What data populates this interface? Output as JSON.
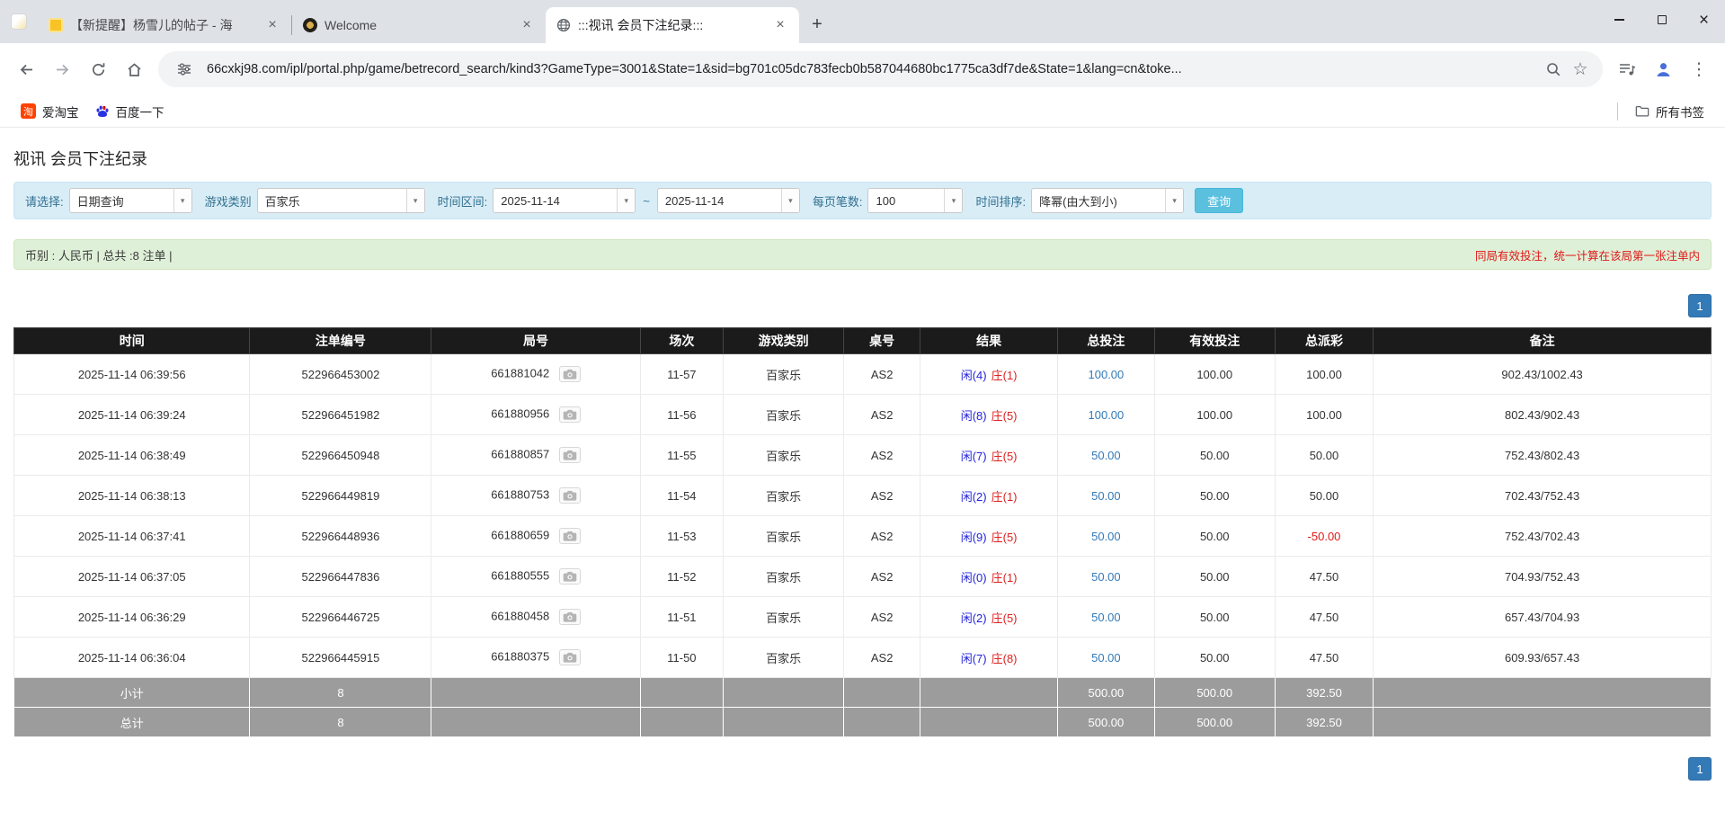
{
  "colors": {
    "filter_bar_bg": "#d9edf7",
    "summary_bar_bg": "#dff0d8",
    "search_button_bg": "#5bc0de",
    "pager_blue": "#337ab7",
    "table_header_bg": "#1b1b1b",
    "footer_row_bg": "#9c9c9c",
    "player_blue": "#2222dd",
    "banker_red": "#dd2222",
    "negative_red": "#e01717",
    "link_blue": "#337ab7"
  },
  "icons": {
    "close": "×",
    "new_tab": "+",
    "chevron_down": "▾",
    "star": "☆",
    "menu": "⋮",
    "window_close": "×"
  },
  "browser": {
    "tabs": [
      {
        "title": "【新提醒】杨雪儿的帖子 - 海"
      },
      {
        "title": "Welcome"
      },
      {
        "title": ":::视讯 会员下注纪录:::"
      }
    ],
    "url": "66cxkj98.com/ipl/portal.php/game/betrecord_search/kind3?GameType=3001&State=1&sid=bg701c05dc783fecb0b587044680bc1775ca3df7de&State=1&lang=cn&toke...",
    "bookmarks": {
      "taobao_label": "爱淘宝",
      "taobao_glyph": "淘",
      "baidu_label": "百度一下",
      "all_bookmarks_label": "所有书签"
    }
  },
  "page": {
    "title": "视讯 会员下注纪录",
    "filters": {
      "select_label": "请选择:",
      "select_value": "日期查询",
      "game_type_label": "游戏类别",
      "game_type_value": "百家乐",
      "date_range_label": "时间区间:",
      "date_from": "2025-11-14",
      "date_separator": "~",
      "date_to": "2025-11-14",
      "page_size_label": "每页笔数:",
      "page_size_value": "100",
      "sort_label": "时间排序:",
      "sort_value": "降幂(由大到小)",
      "search_button": "查询"
    },
    "summary": {
      "left": "币别 : 人民币 | 总共 :8 注单 |",
      "right": "同局有效投注，统一计算在该局第一张注单内"
    },
    "pagination": "1",
    "table": {
      "headers": [
        "时间",
        "注单编号",
        "局号",
        "场次",
        "游戏类别",
        "桌号",
        "结果",
        "总投注",
        "有效投注",
        "总派彩",
        "备注"
      ],
      "rows": [
        {
          "time": "2025-11-14 06:39:56",
          "bet_id": "522966453002",
          "round": "661881042",
          "session": "11-57",
          "game": "百家乐",
          "table_no": "AS2",
          "result_player": "闲(4)",
          "result_banker": "庄(1)",
          "total_bet": "100.00",
          "valid_bet": "100.00",
          "payout": "100.00",
          "note": "902.43/1002.43"
        },
        {
          "time": "2025-11-14 06:39:24",
          "bet_id": "522966451982",
          "round": "661880956",
          "session": "11-56",
          "game": "百家乐",
          "table_no": "AS2",
          "result_player": "闲(8)",
          "result_banker": "庄(5)",
          "total_bet": "100.00",
          "valid_bet": "100.00",
          "payout": "100.00",
          "note": "802.43/902.43"
        },
        {
          "time": "2025-11-14 06:38:49",
          "bet_id": "522966450948",
          "round": "661880857",
          "session": "11-55",
          "game": "百家乐",
          "table_no": "AS2",
          "result_player": "闲(7)",
          "result_banker": "庄(5)",
          "total_bet": "50.00",
          "valid_bet": "50.00",
          "payout": "50.00",
          "note": "752.43/802.43"
        },
        {
          "time": "2025-11-14 06:38:13",
          "bet_id": "522966449819",
          "round": "661880753",
          "session": "11-54",
          "game": "百家乐",
          "table_no": "AS2",
          "result_player": "闲(2)",
          "result_banker": "庄(1)",
          "total_bet": "50.00",
          "valid_bet": "50.00",
          "payout": "50.00",
          "note": "702.43/752.43"
        },
        {
          "time": "2025-11-14 06:37:41",
          "bet_id": "522966448936",
          "round": "661880659",
          "session": "11-53",
          "game": "百家乐",
          "table_no": "AS2",
          "result_player": "闲(9)",
          "result_banker": "庄(5)",
          "total_bet": "50.00",
          "valid_bet": "50.00",
          "payout": "-50.00",
          "note": "752.43/702.43"
        },
        {
          "time": "2025-11-14 06:37:05",
          "bet_id": "522966447836",
          "round": "661880555",
          "session": "11-52",
          "game": "百家乐",
          "table_no": "AS2",
          "result_player": "闲(0)",
          "result_banker": "庄(1)",
          "total_bet": "50.00",
          "valid_bet": "50.00",
          "payout": "47.50",
          "note": "704.93/752.43"
        },
        {
          "time": "2025-11-14 06:36:29",
          "bet_id": "522966446725",
          "round": "661880458",
          "session": "11-51",
          "game": "百家乐",
          "table_no": "AS2",
          "result_player": "闲(2)",
          "result_banker": "庄(5)",
          "total_bet": "50.00",
          "valid_bet": "50.00",
          "payout": "47.50",
          "note": "657.43/704.93"
        },
        {
          "time": "2025-11-14 06:36:04",
          "bet_id": "522966445915",
          "round": "661880375",
          "session": "11-50",
          "game": "百家乐",
          "table_no": "AS2",
          "result_player": "闲(7)",
          "result_banker": "庄(8)",
          "total_bet": "50.00",
          "valid_bet": "50.00",
          "payout": "47.50",
          "note": "609.93/657.43"
        }
      ],
      "subtotal": {
        "label": "小计",
        "count": "8",
        "total_bet": "500.00",
        "valid_bet": "500.00",
        "payout": "392.50"
      },
      "total": {
        "label": "总计",
        "count": "8",
        "total_bet": "500.00",
        "valid_bet": "500.00",
        "payout": "392.50"
      }
    }
  }
}
